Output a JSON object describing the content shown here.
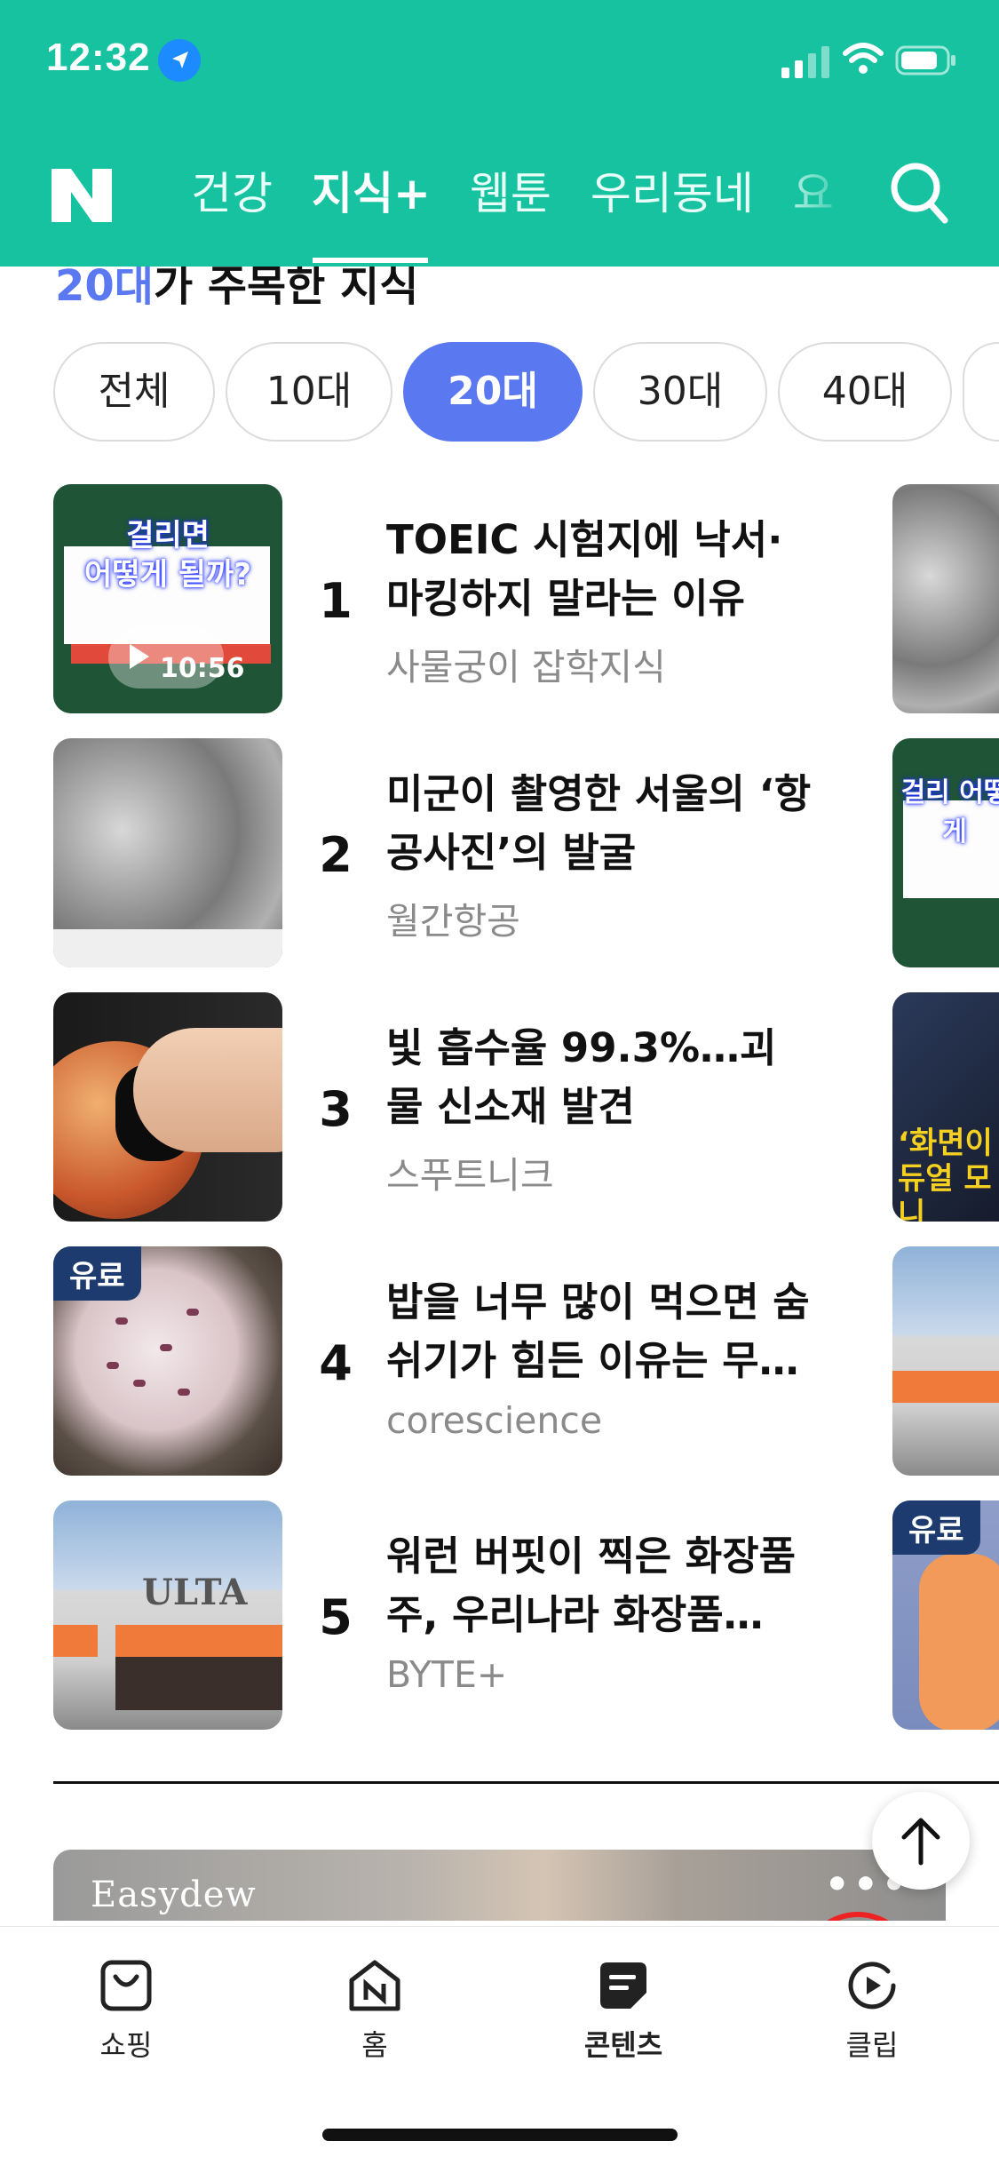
{
  "status_bar": {
    "time": "12:32"
  },
  "top_nav": {
    "logo": "N",
    "tabs": [
      {
        "label": "건강",
        "active": false
      },
      {
        "label": "지식+",
        "active": true
      },
      {
        "label": "웹툰",
        "active": false
      },
      {
        "label": "우리동네",
        "active": false
      },
      {
        "label": "요",
        "active": false
      }
    ],
    "accent_color": "#16c2a0"
  },
  "section": {
    "heading_accent": "20대",
    "heading_rest": "가 주목한 지식"
  },
  "age_filters": {
    "options": [
      "전체",
      "10대",
      "20대",
      "30대",
      "40대",
      ""
    ],
    "selected": "20대",
    "selected_color": "#5a78f0"
  },
  "ranked_list": [
    {
      "rank": "1",
      "title": "TOEIC 시험지에 낙서·마킹하지 말라는 이유",
      "source": "사물궁이 잡학지식",
      "thumb_caption_1": "걸리면",
      "thumb_caption_2": "어떻게 될까?",
      "duration": "10:56"
    },
    {
      "rank": "2",
      "title": "미군이 촬영한 서울의 ‘항공사진’의 발굴",
      "source": "월간항공"
    },
    {
      "rank": "3",
      "title": "빛 흡수율 99.3%…괴물 신소재 발견",
      "source": "스푸트니크"
    },
    {
      "rank": "4",
      "title": "밥을 너무 많이 먹으면 숨쉬기가 힘든 이유는 무엇…",
      "source": "corescience",
      "badge": "유료"
    },
    {
      "rank": "5",
      "title": "워런 버핏이 찍은 화장품주, 우리나라 화장품 업…",
      "source": "BYTE+",
      "thumb_text": "ULTA"
    }
  ],
  "peek_column": {
    "text_3": "‘화면이 듀얼 모니",
    "badge_5": "유료",
    "caption_2": "걸리 어떻게"
  },
  "ad": {
    "brand": "Easydew",
    "more": "•••"
  },
  "bottom_tabs": [
    {
      "label": "쇼핑",
      "icon": "shopping-bag-icon",
      "active": false
    },
    {
      "label": "홈",
      "icon": "home-icon",
      "active": false
    },
    {
      "label": "콘텐츠",
      "icon": "content-icon",
      "active": true
    },
    {
      "label": "클립",
      "icon": "clip-icon",
      "active": false
    }
  ]
}
